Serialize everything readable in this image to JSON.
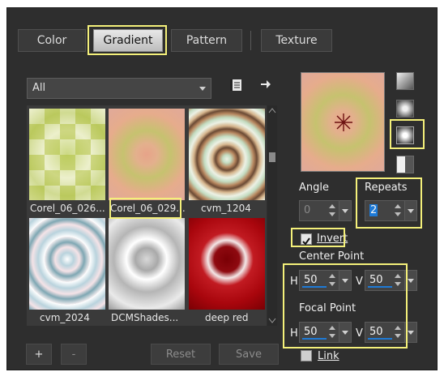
{
  "tabs": [
    {
      "label": "Color",
      "active": false
    },
    {
      "label": "Gradient",
      "active": true
    },
    {
      "label": "Pattern",
      "active": false
    },
    {
      "label": "Texture",
      "active": false
    }
  ],
  "filter": {
    "value": "All"
  },
  "gradients": [
    {
      "label": "Corel_06_026..."
    },
    {
      "label": "Corel_06_029..."
    },
    {
      "label": "cvm_1204"
    },
    {
      "label": "cvm_2024"
    },
    {
      "label": "DCMShades..."
    },
    {
      "label": "deep red"
    }
  ],
  "buttons": {
    "add": "+",
    "remove": "-",
    "reset": "Reset",
    "save": "Save"
  },
  "angle": {
    "label": "Angle",
    "value": "0"
  },
  "repeats": {
    "label": "Repeats",
    "value": "2"
  },
  "invert": {
    "label": "Invert",
    "checked": true
  },
  "center_point": {
    "label": "Center Point",
    "h_label": "H",
    "h": "50",
    "v_label": "V",
    "v": "50"
  },
  "focal_point": {
    "label": "Focal Point",
    "h_label": "H",
    "h": "50",
    "v_label": "V",
    "v": "50"
  },
  "link": {
    "label": "Link",
    "checked": false
  },
  "colors": {
    "panel": "#2e2e2e",
    "highlight": "#f4f07a",
    "accent": "#1e7ad6"
  },
  "icons": [
    "chevron-down-icon",
    "library-icon",
    "arrow-right-icon",
    "crosshair-icon",
    "checkbox-icon"
  ]
}
